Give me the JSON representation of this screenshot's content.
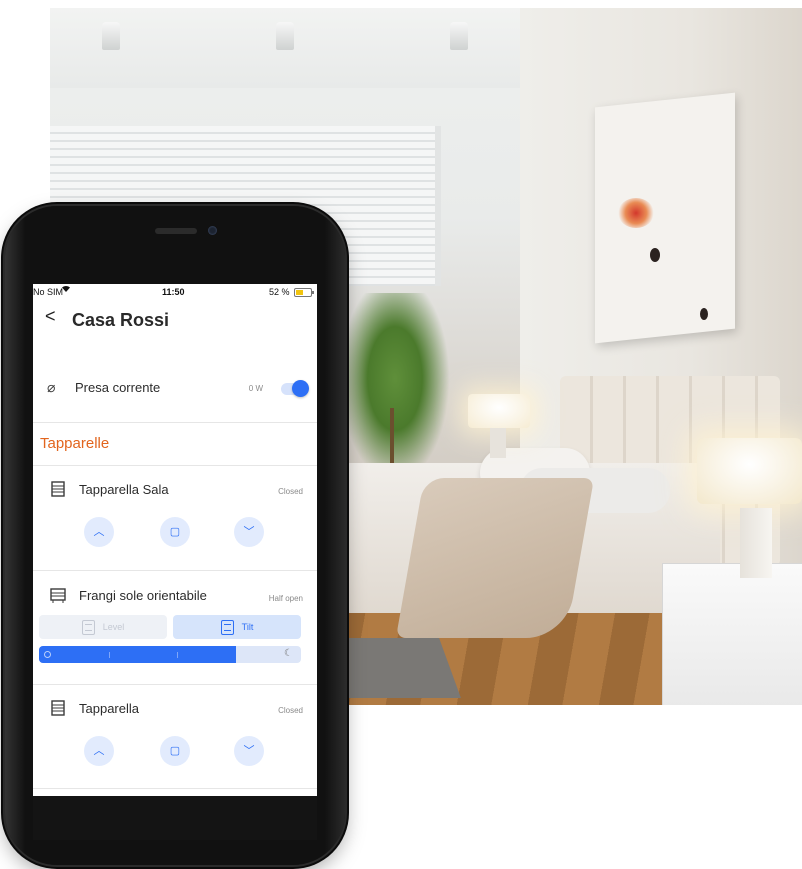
{
  "phone": {
    "status_bar": {
      "carrier": "No SIM",
      "wifi_icon": "wifi-icon",
      "time": "11:50",
      "battery_percent": "52 %",
      "battery_level": 0.52,
      "battery_color": "#f1c40f"
    },
    "header": {
      "back_icon": "chevron-left-icon",
      "back_glyph": "<",
      "title": "Casa Rossi"
    },
    "presa": {
      "icon": "plug-off-icon",
      "icon_glyph": "⌀",
      "label": "Presa corrente",
      "power": "0 W",
      "toggle_on": true
    },
    "section": {
      "title": "Tapparelle",
      "color": "#e2651e"
    },
    "devices": [
      {
        "icon": "shutter-icon",
        "name": "Tapparella Sala",
        "status": "Closed",
        "controls": [
          {
            "icon": "chevron-up-icon",
            "glyph": "︿"
          },
          {
            "icon": "stop-icon",
            "glyph": "▢"
          },
          {
            "icon": "chevron-down-icon",
            "glyph": "﹀"
          }
        ]
      },
      {
        "icon": "awning-icon",
        "name": "Frangi sole orientabile",
        "status": "Half open",
        "segments": {
          "level_label": "Level",
          "tilt_label": "Tilt",
          "selected": "Tilt"
        },
        "slider_level": 0.75,
        "slider_end_icon": "moon-icon",
        "slider_end_glyph": "☾"
      },
      {
        "icon": "shutter-icon",
        "name": "Tapparella",
        "status": "Closed",
        "controls": [
          {
            "icon": "chevron-up-icon",
            "glyph": "︿"
          },
          {
            "icon": "stop-icon",
            "glyph": "▢"
          },
          {
            "icon": "chevron-down-icon",
            "glyph": "﹀"
          }
        ]
      }
    ],
    "accent_color": "#2d6ff5",
    "accent_light": "#e2ebfd"
  }
}
